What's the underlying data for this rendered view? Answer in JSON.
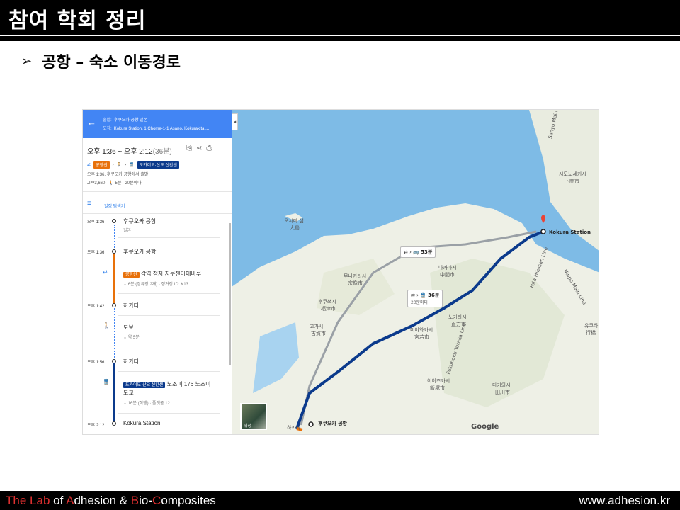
{
  "slide": {
    "title": "참여 학회 정리",
    "bullet": "공항 – 숙소 이동경로",
    "bullet_marker": "➢"
  },
  "panel": {
    "from_label": "출발:",
    "from_value": "후쿠오카 공항 일본",
    "to_label": "도착:",
    "to_value": "Kokura Station, 1 Chome-1-1 Asano, Kokurakita ...",
    "summary_time": "오후 1:36 ~ 오후 2:12",
    "summary_duration": "(36분)",
    "route_badge1": "공항선",
    "route_badge2": "도카이도·산요 신칸센",
    "depart_line": "오후 1:36, 후쿠오카 공항에서 출발",
    "fare_line": "JP¥3,660",
    "walk": "5분",
    "freq": "20분마다",
    "schedule_link": "일정 탐색기",
    "stops": [
      {
        "time": "오후 1:36",
        "name": "후쿠오카 공항",
        "sub": "일본"
      },
      {
        "time": "오후 1:36",
        "name": "후쿠오카 공항"
      },
      {
        "time": "오후 1:42",
        "name": "하카타"
      },
      {
        "time": "오후 1:56",
        "name": "하카타"
      },
      {
        "time": "오후 2:12",
        "name": "Kokura Station"
      }
    ],
    "leg1_badge": "공항선",
    "leg1_text": "각역 정차 지쿠젠마에바루",
    "leg1_sub": "6분 (정류장 2개) · 정거장 ID: K13",
    "leg2_text": "도보",
    "leg2_sub": "약 5분",
    "leg3_badge": "도카이도·산요 신칸센",
    "leg3_text": "노조미 176 노조미",
    "leg3_text2": "도쿄",
    "leg3_sub": "16분 (직행) · 플랫폼 12"
  },
  "map": {
    "callout1_time": "53분",
    "callout2_time": "36분",
    "callout2_sub": "20분마다",
    "start_label": "후쿠오카 공항",
    "end_label": "Kokura Station",
    "hakata_label": "하카타",
    "google": "Google",
    "thumb_label": "위성",
    "places": [
      {
        "t": "시모노세키시",
        "k": "shimonoseki"
      },
      {
        "t": "下関市",
        "k": "shimonoseki-kanji"
      },
      {
        "t": "오시마 섬",
        "k": "oshima"
      },
      {
        "t": "大島",
        "k": "oshima-kanji"
      },
      {
        "t": "나카마시",
        "k": "nakama"
      },
      {
        "t": "中間市",
        "k": "nakama-kanji"
      },
      {
        "t": "무나카타시",
        "k": "munakata"
      },
      {
        "t": "宗像市",
        "k": "munakata-kanji"
      },
      {
        "t": "후쿠쓰시",
        "k": "fukutsu"
      },
      {
        "t": "福津市",
        "k": "fukutsu-kanji"
      },
      {
        "t": "고가시",
        "k": "koga"
      },
      {
        "t": "古賀市",
        "k": "koga-kanji"
      },
      {
        "t": "노가타시",
        "k": "nogata"
      },
      {
        "t": "直方市",
        "k": "nogata-kanji"
      },
      {
        "t": "미야와카시",
        "k": "miyawaka"
      },
      {
        "t": "宮若市",
        "k": "miyawaka-kanji"
      },
      {
        "t": "이이즈카시",
        "k": "iizuka"
      },
      {
        "t": "飯塚市",
        "k": "iizuka-kanji"
      },
      {
        "t": "다가와시",
        "k": "tagawa"
      },
      {
        "t": "田川市",
        "k": "tagawa-kanji"
      },
      {
        "t": "유쿠하",
        "k": "yukuhashi"
      },
      {
        "t": "行橋",
        "k": "yukuhashi-kanji"
      },
      {
        "t": "Sanyo Main Line",
        "k": "sanyo-line"
      },
      {
        "t": "Hita Hikosan Line",
        "k": "hita-line"
      },
      {
        "t": "Nippo Main Line",
        "k": "nippo-line"
      },
      {
        "t": "Fukuhoku Yutaka Line",
        "k": "fukuhoku-line"
      }
    ]
  },
  "footer": {
    "lab_t": "T",
    "lab_he": "he ",
    "lab_l": "L",
    "lab_ab": "ab ",
    "lab_of": "of ",
    "lab_a": "A",
    "lab_dhesion": "dhesion & ",
    "lab_b": "B",
    "lab_io": "io-",
    "lab_c": "C",
    "lab_omposites": "omposites",
    "url": "www.adhesion.kr"
  },
  "colors": {
    "header_bg": "#000000",
    "route_blue": "#0b3a8c",
    "route_orange": "#e8710a",
    "sea": "#7ebbe6",
    "land": "#eef0e6",
    "panel_header": "#4285f4",
    "footer_accent": "#e03030"
  }
}
